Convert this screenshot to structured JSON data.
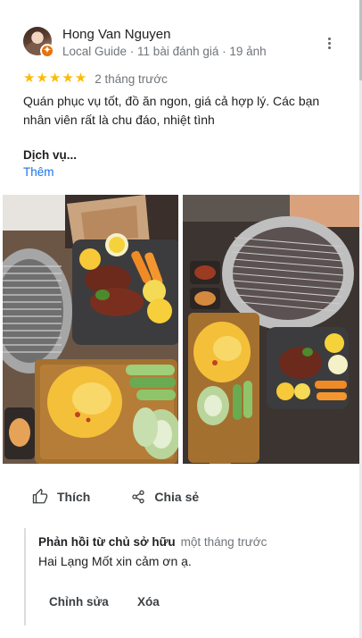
{
  "review": {
    "author_name": "Hong Van Nguyen",
    "author_meta": "Local Guide · 11 bài đánh giá · 19 ảnh",
    "rating": 5,
    "stars": "★★★★★",
    "time_ago": "2 tháng trước",
    "text": "Quán phục vụ tốt, đồ ăn ngon, giá cả hợp lý. Các bạn nhân viên rất là chu đáo, nhiệt tình",
    "service_label": "Dịch vụ...",
    "more_label": "Thêm"
  },
  "actions": {
    "like_label": "Thích",
    "share_label": "Chia sẻ"
  },
  "owner_reply": {
    "owner_label": "Phản hồi từ chủ sở hữu",
    "time_ago": "một tháng trước",
    "text": "Hai Lạng Mốt xin cảm ơn ạ.",
    "edit_label": "Chỉnh sửa",
    "delete_label": "Xóa"
  },
  "colors": {
    "star": "#fbbc04",
    "link": "#1a73e8",
    "badge": "#e8710a"
  }
}
